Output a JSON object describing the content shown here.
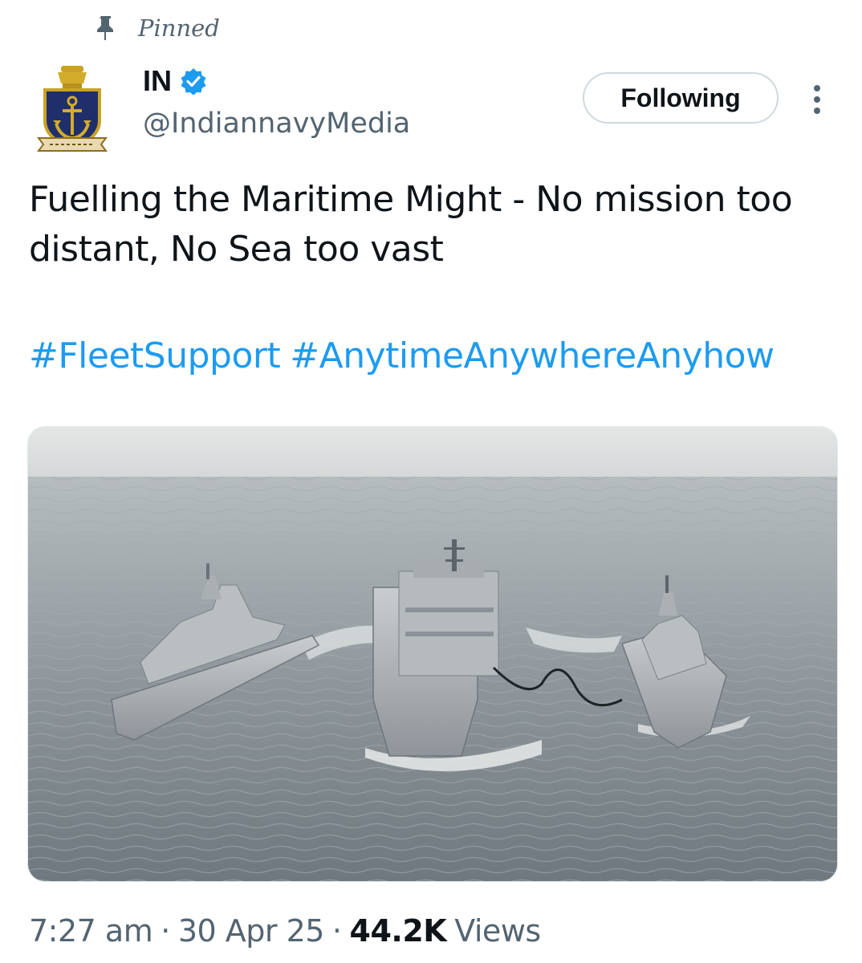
{
  "pinned": {
    "label": "Pinned",
    "icon": "pin-icon"
  },
  "author": {
    "display_name": "IN",
    "handle": "@IndiannavyMedia",
    "verified_icon": "verified-badge-icon",
    "avatar_icon": "indian-navy-crest-icon"
  },
  "follow_button": {
    "label": "Following"
  },
  "more_icon": "more-vertical-icon",
  "tweet": {
    "text": "Fuelling the Maritime Might - No mission too distant, No Sea too vast",
    "hashtags": [
      "#FleetSupport",
      "#AnytimeAnywhereAnyhow"
    ]
  },
  "media": {
    "alt_icon": "three-warships-refuelling-at-sea-image"
  },
  "meta": {
    "time": "7:27 am",
    "date": "30 Apr 25",
    "views_count": "44.2K",
    "views_label": "Views",
    "separator": "·"
  },
  "colors": {
    "accent": "#1d9bf0",
    "text_primary": "#0f1419",
    "text_secondary": "#536471",
    "border": "#cfd9de"
  }
}
